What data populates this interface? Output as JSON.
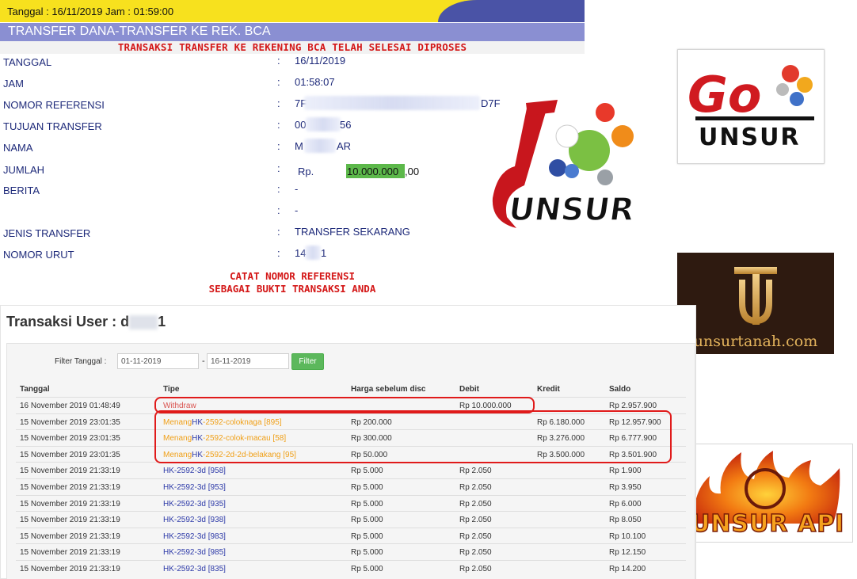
{
  "receipt": {
    "header_datetime": "Tanggal : 16/11/2019 Jam : 01:59:00",
    "title": "TRANSFER DANA-TRANSFER KE REK. BCA",
    "success_message": "TRANSAKSI TRANSFER KE REKENING BCA TELAH SELESAI DIPROSES",
    "fields": {
      "tanggal": {
        "label": "TANGGAL",
        "value": "16/11/2019"
      },
      "jam": {
        "label": "JAM",
        "value": "01:58:07"
      },
      "nomor_referensi": {
        "label": "NOMOR REFERENSI",
        "value_start": "7F",
        "value_end": "D7F"
      },
      "tujuan_transfer": {
        "label": "TUJUAN TRANSFER",
        "value_start": "00",
        "value_end": "56"
      },
      "nama": {
        "label": "NAMA",
        "value_start": "M",
        "value_end": "AR"
      },
      "jumlah": {
        "label": "JUMLAH",
        "currency": "Rp.",
        "amount_main": "10.000.000",
        "amount_decimal": ",00"
      },
      "berita": {
        "label": "BERITA",
        "value": "-",
        "value2": "-"
      },
      "jenis_transfer": {
        "label": "JENIS TRANSFER",
        "value": "TRANSFER SEKARANG"
      },
      "nomor_urut": {
        "label": "NOMOR URUT",
        "value_start": "14",
        "value_end": "1"
      }
    },
    "colon": ":",
    "note_line1": "CATAT NOMOR REFERENSI",
    "note_line2": "SEBAGAI BUKTI TRANSAKSI ANDA"
  },
  "transactions": {
    "title_prefix": "Transaksi User : d",
    "title_suffix": "1",
    "filter": {
      "label": "Filter Tanggal :",
      "from": "01-11-2019",
      "separator": "-",
      "to": "16-11-2019",
      "button": "Filter"
    },
    "columns": [
      "Tanggal",
      "Tipe",
      "Harga sebelum disc",
      "Debit",
      "Kredit",
      "Saldo"
    ],
    "rows": [
      {
        "tanggal": "16 November 2019 01:48:49",
        "tipe_prefix": "",
        "tipe_link": "",
        "tipe_rest": "Withdraw",
        "harga": "",
        "debit": "Rp 10.000.000",
        "kredit": "",
        "saldo": "Rp 2.957.900"
      },
      {
        "tanggal": "15 November 2019 23:01:35",
        "tipe_prefix": "Menang",
        "tipe_link": "HK",
        "tipe_rest": "-2592-coloknaga [895]",
        "harga": "Rp 200.000",
        "debit": "",
        "kredit": "Rp 6.180.000",
        "saldo": "Rp 12.957.900"
      },
      {
        "tanggal": "15 November 2019 23:01:35",
        "tipe_prefix": "Menang",
        "tipe_link": "HK",
        "tipe_rest": "-2592-colok-macau [58]",
        "harga": "Rp 300.000",
        "debit": "",
        "kredit": "Rp 3.276.000",
        "saldo": "Rp 6.777.900"
      },
      {
        "tanggal": "15 November 2019 23:01:35",
        "tipe_prefix": "Menang",
        "tipe_link": "HK",
        "tipe_rest": "-2592-2d-2d-belakang [95]",
        "harga": "Rp 50.000",
        "debit": "",
        "kredit": "Rp 3.500.000",
        "saldo": "Rp 3.501.900"
      },
      {
        "tanggal": "15 November 2019 21:33:19",
        "tipe_prefix": "",
        "tipe_link": "HK",
        "tipe_rest": "-2592-3d [958]",
        "harga": "Rp 5.000",
        "debit": "Rp 2.050",
        "kredit": "",
        "saldo": "Rp 1.900"
      },
      {
        "tanggal": "15 November 2019 21:33:19",
        "tipe_prefix": "",
        "tipe_link": "HK",
        "tipe_rest": "-2592-3d [953]",
        "harga": "Rp 5.000",
        "debit": "Rp 2.050",
        "kredit": "",
        "saldo": "Rp 3.950"
      },
      {
        "tanggal": "15 November 2019 21:33:19",
        "tipe_prefix": "",
        "tipe_link": "HK",
        "tipe_rest": "-2592-3d [935]",
        "harga": "Rp 5.000",
        "debit": "Rp 2.050",
        "kredit": "",
        "saldo": "Rp 6.000"
      },
      {
        "tanggal": "15 November 2019 21:33:19",
        "tipe_prefix": "",
        "tipe_link": "HK",
        "tipe_rest": "-2592-3d [938]",
        "harga": "Rp 5.000",
        "debit": "Rp 2.050",
        "kredit": "",
        "saldo": "Rp 8.050"
      },
      {
        "tanggal": "15 November 2019 21:33:19",
        "tipe_prefix": "",
        "tipe_link": "HK",
        "tipe_rest": "-2592-3d [983]",
        "harga": "Rp 5.000",
        "debit": "Rp 2.050",
        "kredit": "",
        "saldo": "Rp 10.100"
      },
      {
        "tanggal": "15 November 2019 21:33:19",
        "tipe_prefix": "",
        "tipe_link": "HK",
        "tipe_rest": "-2592-3d [985]",
        "harga": "Rp 5.000",
        "debit": "Rp 2.050",
        "kredit": "",
        "saldo": "Rp 12.150"
      },
      {
        "tanggal": "15 November 2019 21:33:19",
        "tipe_prefix": "",
        "tipe_link": "HK",
        "tipe_rest": "-2592-3d [835]",
        "harga": "Rp 5.000",
        "debit": "Rp 2.050",
        "kredit": "",
        "saldo": "Rp 14.200"
      }
    ]
  },
  "logos": {
    "five_unsur": "UNSUR",
    "go_unsur_top": "Go",
    "go_unsur_bottom": "UNSUR",
    "unsurtanah": "unsurtanah.com",
    "unsur_api": "UNSUR API"
  },
  "colors": {
    "topbar_yellow": "#f7e11e",
    "title_purple": "#8a8fd2",
    "receipt_text": "#1e2a7a",
    "alert_red": "#d41818",
    "amount_highlight": "#5cb84a",
    "filter_button": "#5cb85c",
    "menang_orange": "#f0a018",
    "link_blue": "#2d3aa8",
    "ring_red": "#e01a1a"
  }
}
